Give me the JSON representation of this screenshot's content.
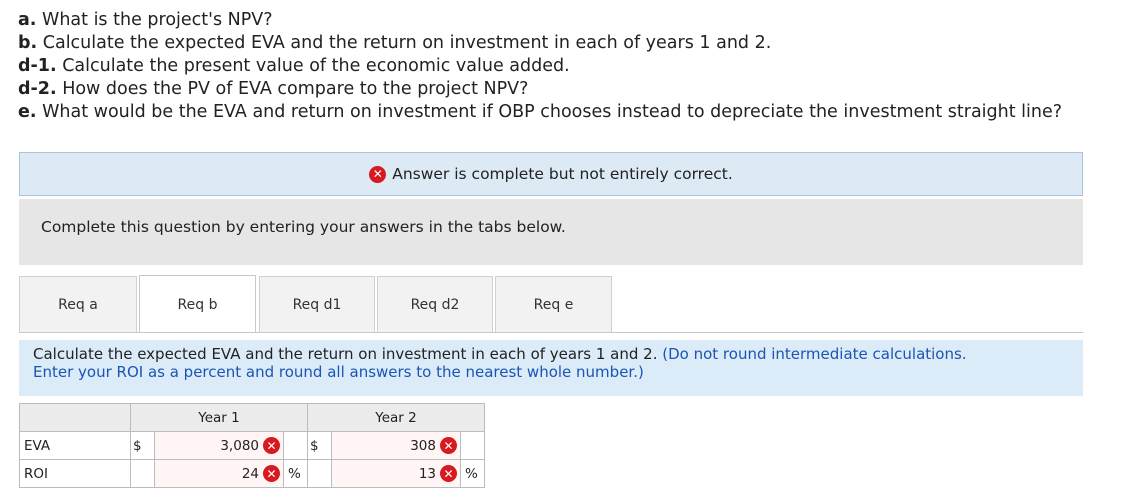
{
  "questions": [
    {
      "label": "a.",
      "text": " What is the project's NPV?"
    },
    {
      "label": "b.",
      "text": " Calculate the expected EVA and the return on investment in each of years 1 and 2."
    },
    {
      "label": "d-1.",
      "text": " Calculate the present value of the economic value added."
    },
    {
      "label": "d-2.",
      "text": " How does the PV of EVA compare to the project NPV?"
    },
    {
      "label": "e.",
      "text": " What would be the EVA and return on investment if OBP chooses instead to depreciate the investment straight line?"
    }
  ],
  "banner": {
    "text": "Answer is complete but not entirely correct.",
    "icon": "x-icon",
    "color": "#d71920"
  },
  "complete_text": "Complete this question by entering your answers in the tabs below.",
  "tabs": [
    {
      "label": "Req a",
      "active": false
    },
    {
      "label": "Req b",
      "active": true
    },
    {
      "label": "Req d1",
      "active": false
    },
    {
      "label": "Req d2",
      "active": false
    },
    {
      "label": "Req e",
      "active": false
    }
  ],
  "instructions": {
    "main": "Calculate the expected EVA and the return on investment in each of years 1 and 2.",
    "note_line1": "(Do not round intermediate calculations.",
    "note_line2": "Enter your ROI as a percent and round all answers to the nearest whole number.)"
  },
  "table": {
    "headers": [
      "Year 1",
      "Year 2"
    ],
    "rows": [
      {
        "label": "EVA",
        "prefix": "$",
        "y1": "3,080",
        "y2": "308",
        "suffix": ""
      },
      {
        "label": "ROI",
        "prefix": "",
        "y1": "24",
        "y2": "13",
        "suffix": "%"
      }
    ]
  }
}
